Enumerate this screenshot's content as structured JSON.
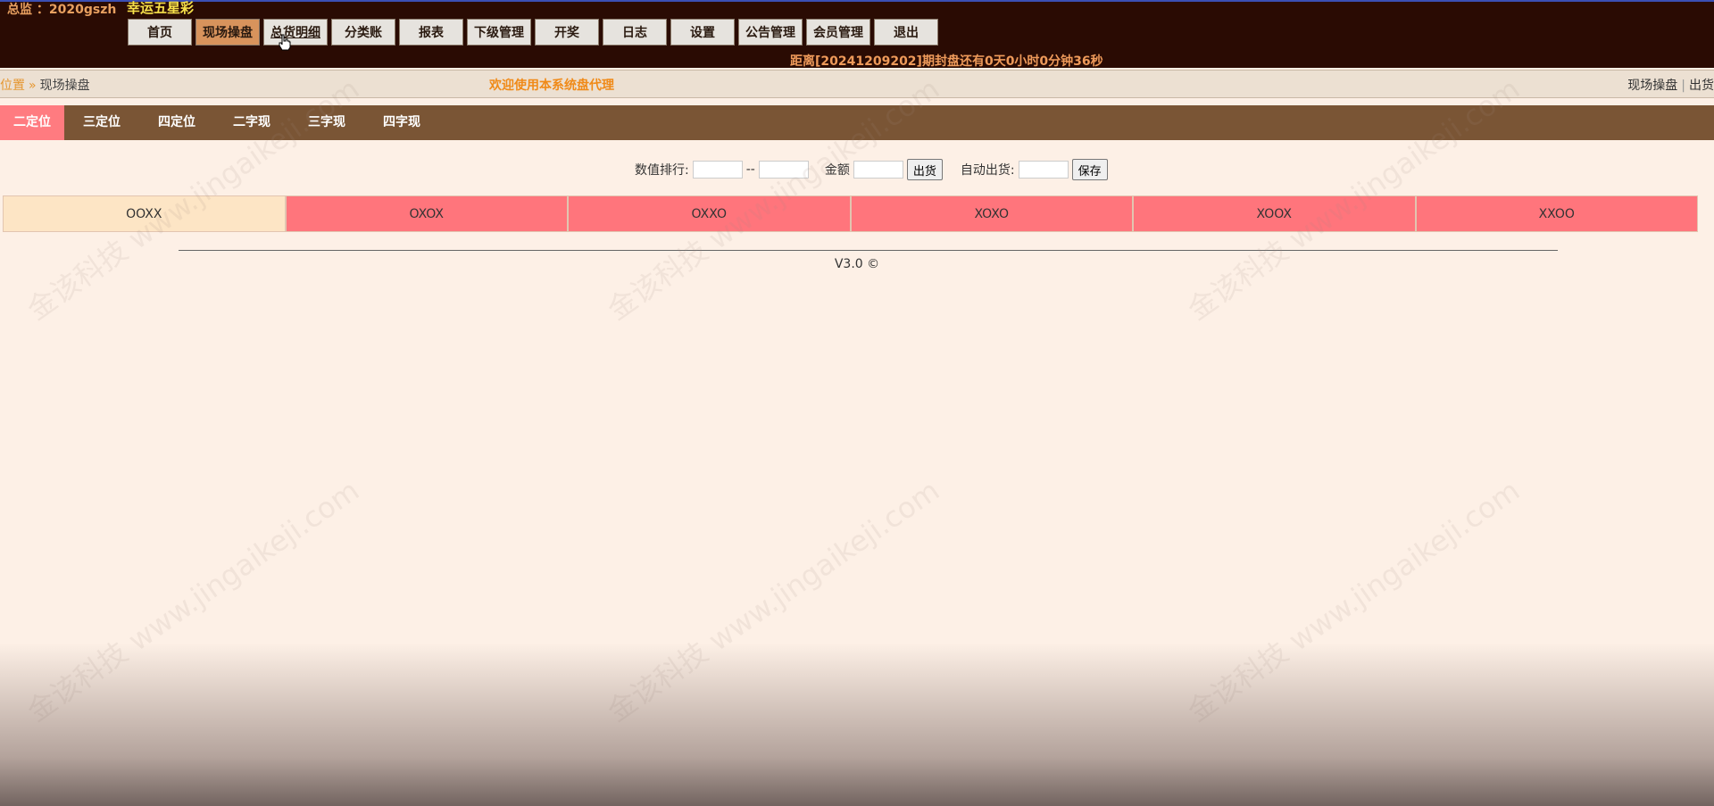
{
  "header": {
    "account_label": "总监 ：2020gszh",
    "lottery_name": "幸运五星彩",
    "nav": [
      {
        "label": "首页"
      },
      {
        "label": "现场操盘",
        "active": true
      },
      {
        "label": "总货明细",
        "hover": true
      },
      {
        "label": "分类账"
      },
      {
        "label": "报表"
      },
      {
        "label": "下级管理"
      },
      {
        "label": "开奖"
      },
      {
        "label": "日志"
      },
      {
        "label": "设置"
      },
      {
        "label": "公告管理"
      },
      {
        "label": "会员管理"
      },
      {
        "label": "退出"
      }
    ],
    "countdown": "距离[20241209202]期封盘还有0天0小时0分钟36秒"
  },
  "breadcrumb": {
    "position_label": "位置",
    "separator": "»",
    "current": "现场操盘",
    "welcome": "欢迎使用本系统盘代理",
    "right_link_1": "现场操盘",
    "right_divider": "|",
    "right_link_2": "出货"
  },
  "tabs": [
    {
      "label": "二定位",
      "active": true
    },
    {
      "label": "三定位"
    },
    {
      "label": "四定位"
    },
    {
      "label": "二字现"
    },
    {
      "label": "三字现"
    },
    {
      "label": "四字现"
    }
  ],
  "filters": {
    "rank_label": "数值排行:",
    "range_sep": "--",
    "rank_from_value": "",
    "rank_to_value": "",
    "amount_label": "金额",
    "amount_value": "",
    "ship_button": "出货",
    "auto_ship_label": "自动出货:",
    "auto_ship_value": "",
    "save_button": "保存"
  },
  "combos": [
    {
      "label": "OOXX",
      "selected": true
    },
    {
      "label": "OXOX"
    },
    {
      "label": "OXXO"
    },
    {
      "label": "XOXO"
    },
    {
      "label": "XOOX"
    },
    {
      "label": "XXOO"
    }
  ],
  "footer": {
    "version": "V3.0  ©"
  },
  "watermark": {
    "text": "金该科技 www.jingaikeji.com"
  },
  "colors": {
    "topbar": "#2a0b03",
    "nav_active": "#d8935c",
    "tab_bar": "#7a5535",
    "tab_active": "#ff7b80",
    "combo": "#ff757c",
    "combo_selected": "#fde5c5",
    "page_bg": "#fdf0e6"
  }
}
